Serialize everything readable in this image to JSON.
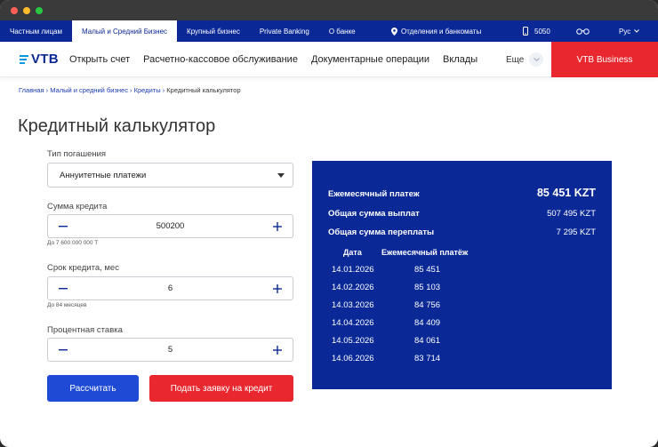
{
  "topnav": {
    "segments": [
      "Частным лицам",
      "Малый и Средний Бизнес",
      "Крупный бизнес",
      "Private Banking",
      "О банке"
    ],
    "branches": "Отделения и банкоматы",
    "phone": "5050",
    "lang": "Рус"
  },
  "mainnav": {
    "logo": "VTB",
    "links": [
      "Открыть счет",
      "Расчетно-кассовое обслуживание",
      "Документарные операции",
      "Вклады"
    ],
    "more": "Еще",
    "business_button": "VTB Business"
  },
  "breadcrumb": {
    "items": [
      "Главная",
      "Малый и средний бизнес",
      "Кредиты"
    ],
    "current": "Кредитный калькулятор",
    "separator": "›"
  },
  "page": {
    "title": "Кредитный калькулятор"
  },
  "form": {
    "repayment": {
      "label": "Тип погашения",
      "value": "Аннуитетные платежи"
    },
    "amount": {
      "label": "Сумма кредита",
      "value": "500200",
      "hint": "До 7 600 000 000 Т"
    },
    "term": {
      "label": "Срок кредита, мес",
      "value": "6",
      "hint": "До 84 месяцев"
    },
    "rate": {
      "label": "Процентная ставка",
      "value": "5"
    },
    "calc_button": "Рассчитать",
    "apply_button": "Подать заявку на кредит"
  },
  "result": {
    "monthly_label": "Ежемесячный платеж",
    "monthly_value": "85 451 KZT",
    "total_label": "Общая сумма выплат",
    "total_value": "507 495 KZT",
    "overpay_label": "Общая сумма переплаты",
    "overpay_value": "7 295 KZT",
    "schedule_headers": [
      "Дата",
      "Ежемесячный платёж"
    ],
    "schedule": [
      {
        "date": "14.01.2026",
        "payment": "85 451"
      },
      {
        "date": "14.02.2026",
        "payment": "85 103"
      },
      {
        "date": "14.03.2026",
        "payment": "84 756"
      },
      {
        "date": "14.04.2026",
        "payment": "84 409"
      },
      {
        "date": "14.05.2026",
        "payment": "84 061"
      },
      {
        "date": "14.06.2026",
        "payment": "83 714"
      }
    ]
  },
  "colors": {
    "brand_blue": "#0a2896",
    "accent_red": "#e8272f",
    "button_blue": "#1e4ad6"
  }
}
